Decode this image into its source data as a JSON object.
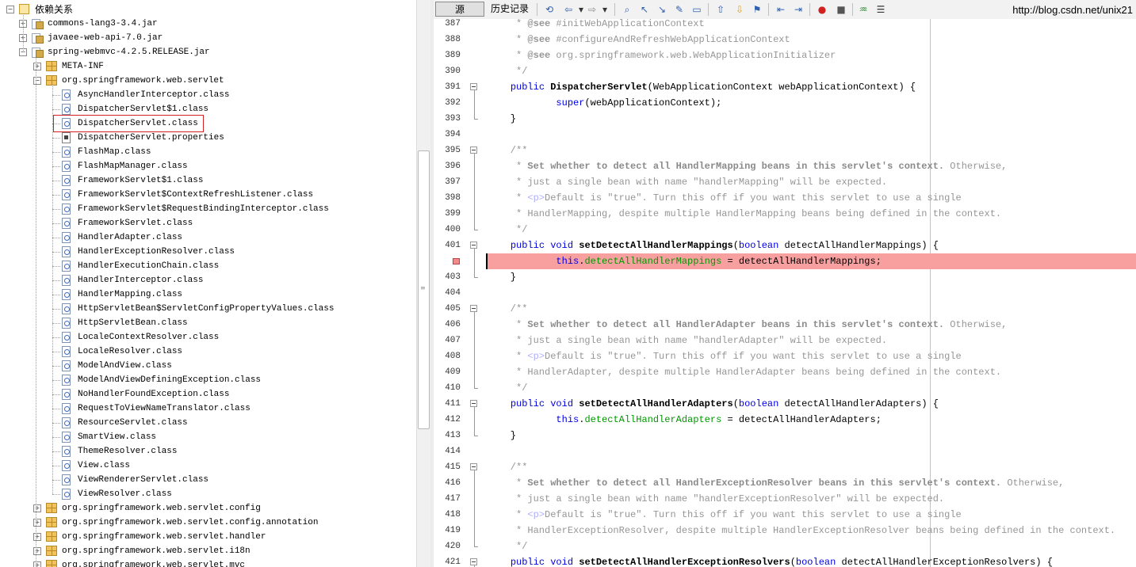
{
  "tree": {
    "root_label": "依赖关系",
    "jars": [
      "commons-lang3-3.4.jar",
      "javaee-web-api-7.0.jar",
      "spring-webmvc-4.2.5.RELEASE.jar"
    ],
    "meta_inf": "META-INF",
    "servlet_package": "org.springframework.web.servlet",
    "classes": [
      "AsyncHandlerInterceptor.class",
      "DispatcherServlet$1.class",
      "DispatcherServlet.class",
      "DispatcherServlet.properties",
      "FlashMap.class",
      "FlashMapManager.class",
      "FrameworkServlet$1.class",
      "FrameworkServlet$ContextRefreshListener.class",
      "FrameworkServlet$RequestBindingInterceptor.class",
      "FrameworkServlet.class",
      "HandlerAdapter.class",
      "HandlerExceptionResolver.class",
      "HandlerExecutionChain.class",
      "HandlerInterceptor.class",
      "HandlerMapping.class",
      "HttpServletBean$ServletConfigPropertyValues.class",
      "HttpServletBean.class",
      "LocaleContextResolver.class",
      "LocaleResolver.class",
      "ModelAndView.class",
      "ModelAndViewDefiningException.class",
      "NoHandlerFoundException.class",
      "RequestToViewNameTranslator.class",
      "ResourceServlet.class",
      "SmartView.class",
      "ThemeResolver.class",
      "View.class",
      "ViewRendererServlet.class",
      "ViewResolver.class"
    ],
    "sub_packages": [
      "org.springframework.web.servlet.config",
      "org.springframework.web.servlet.config.annotation",
      "org.springframework.web.servlet.handler",
      "org.springframework.web.servlet.i18n",
      "org.springframework.web.servlet.mvc"
    ]
  },
  "toolbar": {
    "source_tab": "源",
    "history_tab": "历史记录",
    "watermark": "http://blog.csdn.net/unix21"
  },
  "editor": {
    "breakpoint_line": 402,
    "lines": {
      "l387": "     * @see #initWebApplicationContext",
      "l388": "     * @see #configureAndRefreshWebApplicationContext",
      "l389": "     * @see org.springframework.web.WebApplicationInitializer",
      "l390": "     */",
      "l391": "    public DispatcherServlet(WebApplicationContext webApplicationContext) {",
      "l392": "            super(webApplicationContext);",
      "l393": "    }",
      "l394": "",
      "l395": "    /**",
      "l396": "     * Set whether to detect all HandlerMapping beans in this servlet's context. Otherwise,",
      "l397": "     * just a single bean with name \"handlerMapping\" will be expected.",
      "l398": "     * <p>Default is \"true\". Turn this off if you want this servlet to use a single",
      "l399": "     * HandlerMapping, despite multiple HandlerMapping beans being defined in the context.",
      "l400": "     */",
      "l401": "    public void setDetectAllHandlerMappings(boolean detectAllHandlerMappings) {",
      "l402": "            this.detectAllHandlerMappings = detectAllHandlerMappings;",
      "l403": "    }",
      "l404": "",
      "l405": "    /**",
      "l406": "     * Set whether to detect all HandlerAdapter beans in this servlet's context. Otherwise,",
      "l407": "     * just a single bean with name \"handlerAdapter\" will be expected.",
      "l408": "     * <p>Default is \"true\". Turn this off if you want this servlet to use a single",
      "l409": "     * HandlerAdapter, despite multiple HandlerAdapter beans being defined in the context.",
      "l410": "     */",
      "l411": "    public void setDetectAllHandlerAdapters(boolean detectAllHandlerAdapters) {",
      "l412": "            this.detectAllHandlerAdapters = detectAllHandlerAdapters;",
      "l413": "    }",
      "l414": "",
      "l415": "    /**",
      "l416": "     * Set whether to detect all HandlerExceptionResolver beans in this servlet's context. Otherwise,",
      "l417": "     * just a single bean with name \"handlerExceptionResolver\" will be expected.",
      "l418": "     * <p>Default is \"true\". Turn this off if you want this servlet to use a single",
      "l419": "     * HandlerExceptionResolver, despite multiple HandlerExceptionResolver beans being defined in the context.",
      "l420": "     */",
      "l421": "    public void setDetectAllHandlerExceptionResolvers(boolean detectAllHandlerExceptionResolvers) {"
    }
  }
}
